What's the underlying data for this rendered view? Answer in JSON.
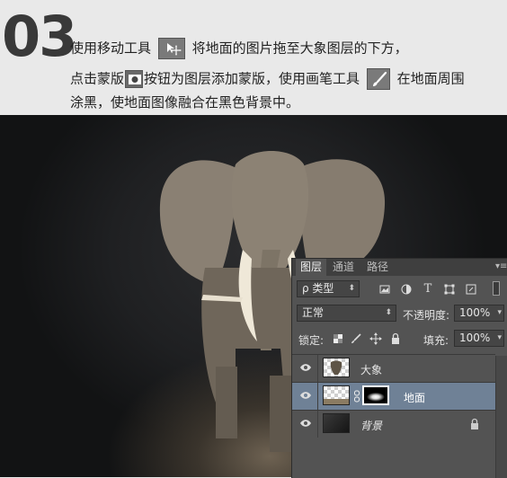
{
  "step": {
    "number": "03"
  },
  "instructions": {
    "line1_a": "使用移动工具",
    "line1_b": "将地面的图片拖至大象图层的下方，",
    "line2_a": "点击蒙版",
    "line2_b": "按钮为图层添加蒙版，使用画笔工具",
    "line2_c": "在地面周围",
    "line3": "涂黑，使地面图像融合在黑色背景中。"
  },
  "icons": {
    "move_tool": "move-tool-icon",
    "mask_button": "add-mask-icon",
    "brush_tool": "brush-tool-icon"
  },
  "layers_panel": {
    "tabs": [
      "图层",
      "通道",
      "路径"
    ],
    "active_tab": "图层",
    "filter_kind": "ρ 类型",
    "blend_mode": "正常",
    "opacity_label": "不透明度:",
    "opacity_value": "100%",
    "lock_label": "锁定:",
    "fill_label": "填充:",
    "fill_value": "100%",
    "layers": [
      {
        "name": "大象",
        "visible": true,
        "selected": false
      },
      {
        "name": "地面",
        "visible": true,
        "selected": true,
        "has_mask": true
      },
      {
        "name": "背景",
        "visible": true,
        "selected": false,
        "locked": true
      }
    ]
  },
  "colors": {
    "panel_bg": "#535353",
    "selected_row": "#6f8196",
    "tab_bar": "#3f3f3f"
  }
}
